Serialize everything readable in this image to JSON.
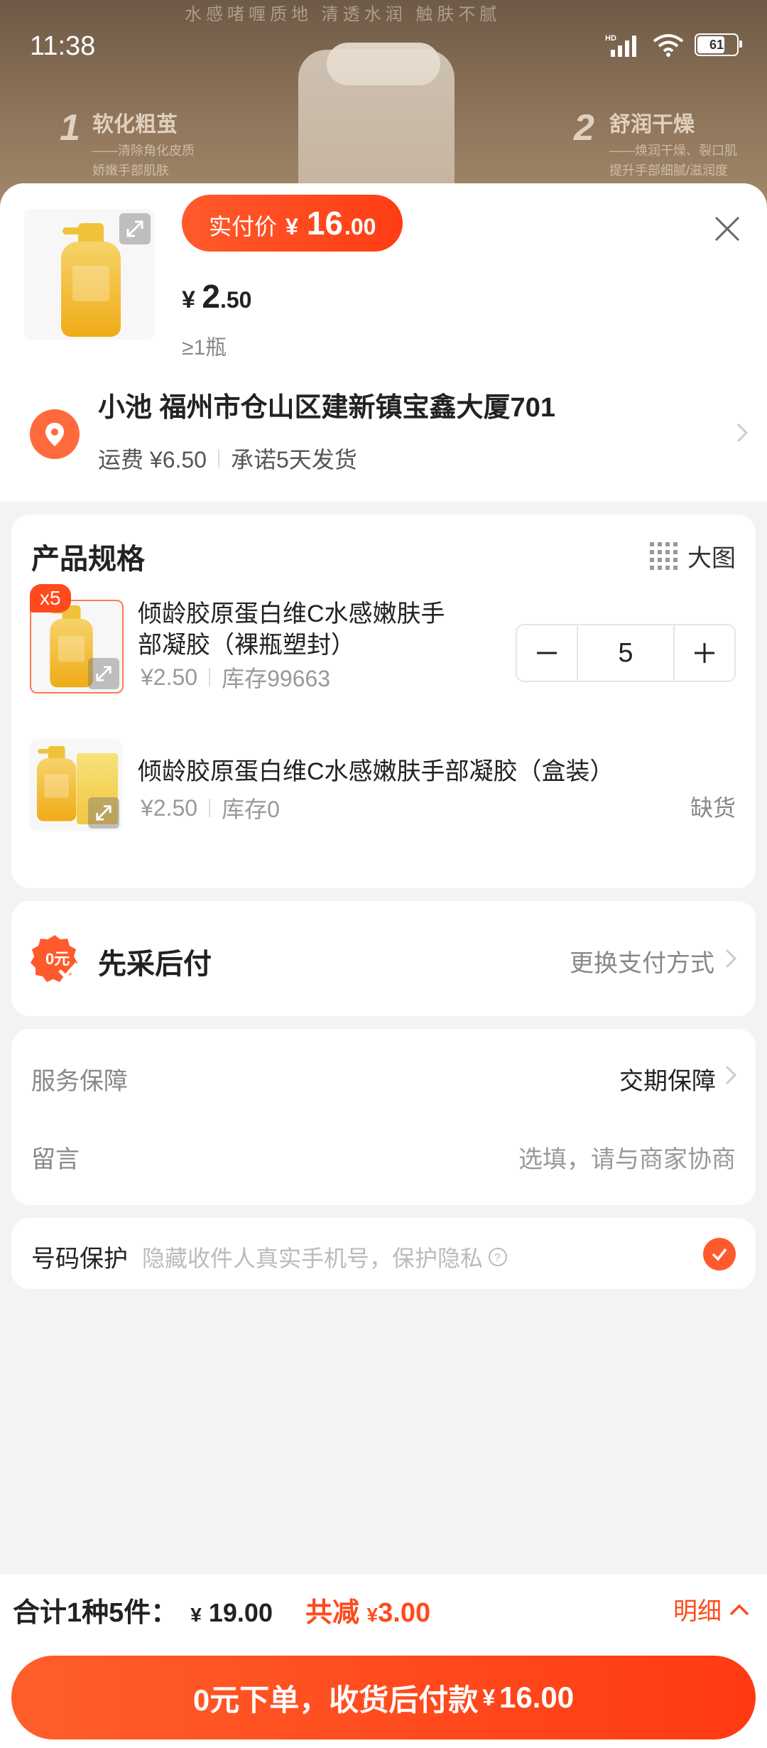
{
  "status": {
    "time": "11:38",
    "battery": "61",
    "hd": "HD"
  },
  "banner": {
    "top_text": "水感啫喱质地    清透水润    触肤不腻",
    "left_num": "1",
    "left_title": "软化粗茧",
    "left_sub1": "——清除角化皮质",
    "left_sub2": "娇嫩手部肌肤",
    "right_num": "2",
    "right_title": "舒润干燥",
    "right_sub1": "——焕润干燥、裂口肌",
    "right_sub2": "提升手部细腻/滋润度"
  },
  "product": {
    "pay_label": "实付价",
    "pay_currency": "¥",
    "pay_int": "16",
    "pay_dec": ".00",
    "unit_currency": "¥ ",
    "unit_int": "2",
    "unit_dec": ".50",
    "min_qty": "≥1瓶"
  },
  "address": {
    "line": "小池 福州市仓山区建新镇宝鑫大厦701",
    "shipping": "运费 ¥6.50",
    "promise": "承诺5天发货"
  },
  "spec": {
    "title": "产品规格",
    "big_pic": "大图",
    "items": [
      {
        "badge": "x5",
        "name_l1": "倾龄胶原蛋白维C水感嫩肤手",
        "name_l2": "部凝胶（裸瓶塑封）",
        "price": "¥2.50",
        "stock": "库存99663",
        "qty": "5"
      },
      {
        "name_l1": "倾龄胶原蛋白维C水感嫩肤手部凝胶（盒装）",
        "price": "¥2.50",
        "stock": "库存0",
        "status": "缺货"
      }
    ]
  },
  "payment": {
    "title": "先采后付",
    "change": "更换支付方式",
    "icon_text": "0元"
  },
  "service": {
    "label": "服务保障",
    "value": "交期保障"
  },
  "message": {
    "label": "留言",
    "placeholder": "选填，请与商家协商"
  },
  "privacy": {
    "label": "号码保护",
    "hint": "隐藏收件人真实手机号，保护隐私"
  },
  "footer": {
    "count": "合计1种5件：",
    "total_cur": "¥",
    "total": "19.00",
    "discount_label": "共减",
    "discount_cur": "¥",
    "discount": "3.00",
    "detail": "明细",
    "cta_text": "0元下单，收货后付款",
    "cta_cur": "¥",
    "cta_amount": "16.00"
  },
  "colors": {
    "accent": "#ff4a1c",
    "accent_grad_start": "#ff5e2b"
  }
}
